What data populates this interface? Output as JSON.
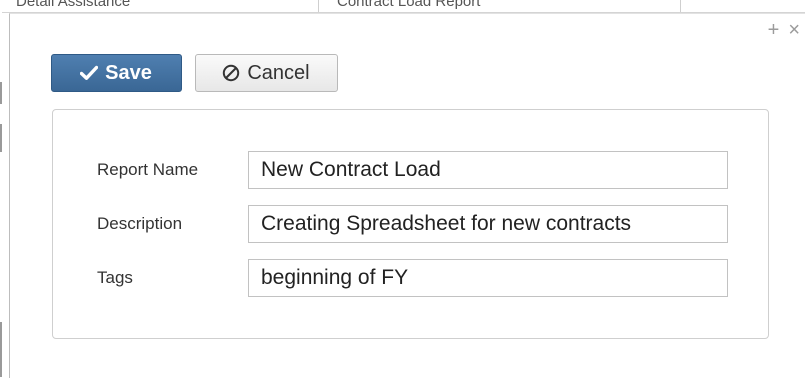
{
  "background": {
    "col1_text": "Detail Assistance",
    "col2_text": "Contract Load Report"
  },
  "window": {
    "expand_glyph": "+",
    "close_glyph": "×"
  },
  "toolbar": {
    "save_label": "Save",
    "save_icon": "check-icon",
    "cancel_label": "Cancel",
    "cancel_icon": "cancel-circle-icon"
  },
  "form": {
    "fields": [
      {
        "label": "Report Name",
        "value": "New Contract Load"
      },
      {
        "label": "Description",
        "value": "Creating Spreadsheet for new contracts"
      },
      {
        "label": "Tags",
        "value": "beginning of FY"
      }
    ]
  },
  "colors": {
    "save_button": "#3f6d9c",
    "panel_border": "#cfcfcf",
    "icon_gray": "#9b9b9b"
  }
}
